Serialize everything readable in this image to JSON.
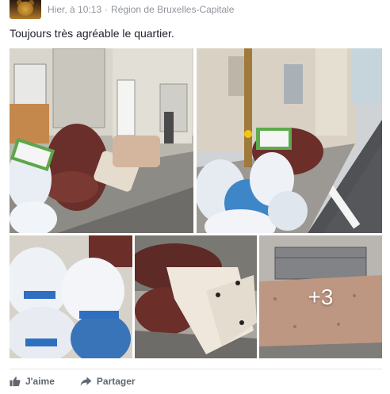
{
  "post": {
    "timestamp": "Hier, à 10:13",
    "separator": "·",
    "location": "Région de Bruxelles-Capitale",
    "privacy_icon": "globe-icon",
    "text": "Toujours très agréable le quartier."
  },
  "gallery": {
    "photos": [
      "photo-armchair-and-trash-bags",
      "photo-sofa-and-trash-bags-street",
      "photo-trash-bags-closeup",
      "photo-armchair-and-mattress",
      "photo-mattress"
    ],
    "more_count": "+3"
  },
  "actions": {
    "like_label": "J'aime",
    "share_label": "Partager",
    "like_icon": "thumbs-up-icon",
    "share_icon": "share-arrow-icon"
  },
  "colors": {
    "meta_text": "#90949c",
    "action_text": "#606770",
    "body_text": "#1d2129"
  }
}
